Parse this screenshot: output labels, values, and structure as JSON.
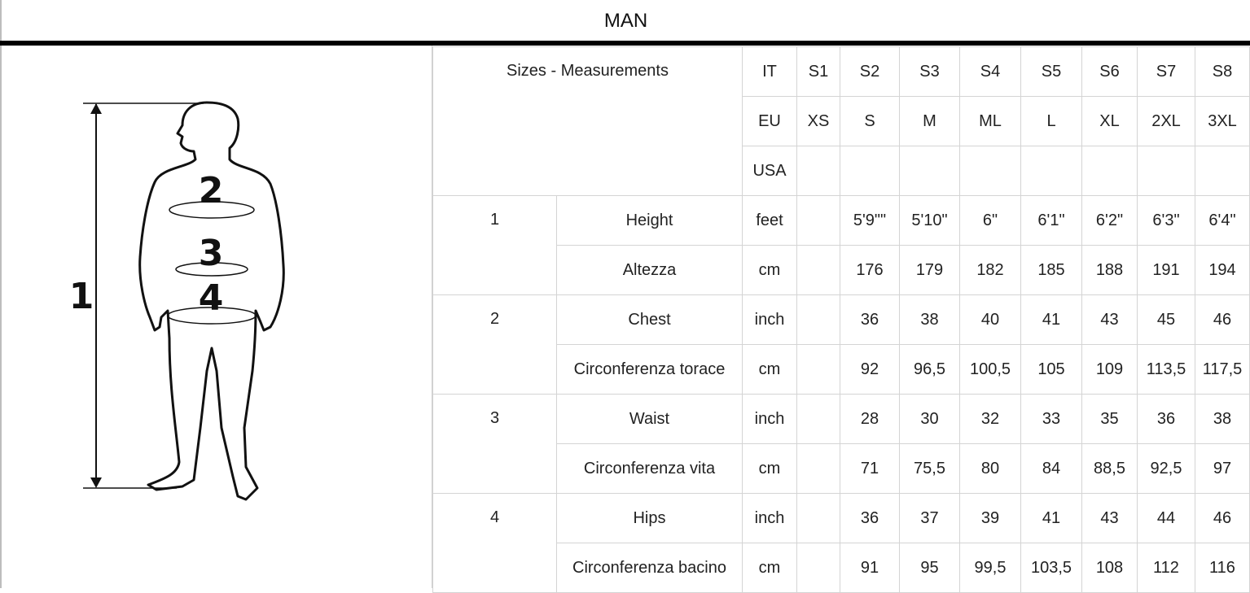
{
  "title": "MAN",
  "figure": {
    "labels": [
      "1",
      "2",
      "3",
      "4"
    ]
  },
  "table": {
    "corner_label": "Sizes - Measurements",
    "size_systems": [
      {
        "system": "IT",
        "sizes": [
          "S1",
          "S2",
          "S3",
          "S4",
          "S5",
          "S6",
          "S7",
          "S8"
        ]
      },
      {
        "system": "EU",
        "sizes": [
          "XS",
          "S",
          "M",
          "ML",
          "L",
          "XL",
          "2XL",
          "3XL"
        ]
      },
      {
        "system": "USA",
        "sizes": [
          "",
          "",
          "",
          "",
          "",
          "",
          "",
          ""
        ]
      }
    ],
    "measurements": [
      {
        "number": "1",
        "rows": [
          {
            "name": "Height",
            "unit": "feet",
            "values": [
              "",
              "5'9\"\"",
              "5'10\"",
              "6\"",
              "6'1\"",
              "6'2\"",
              "6'3\"",
              "6'4\""
            ]
          },
          {
            "name": "Altezza",
            "unit": "cm",
            "values": [
              "",
              "176",
              "179",
              "182",
              "185",
              "188",
              "191",
              "194"
            ]
          }
        ]
      },
      {
        "number": "2",
        "rows": [
          {
            "name": "Chest",
            "unit": "inch",
            "values": [
              "",
              "36",
              "38",
              "40",
              "41",
              "43",
              "45",
              "46"
            ]
          },
          {
            "name": "Circonferenza torace",
            "unit": "cm",
            "values": [
              "",
              "92",
              "96,5",
              "100,5",
              "105",
              "109",
              "113,5",
              "117,5"
            ]
          }
        ]
      },
      {
        "number": "3",
        "rows": [
          {
            "name": "Waist",
            "unit": "inch",
            "values": [
              "",
              "28",
              "30",
              "32",
              "33",
              "35",
              "36",
              "38"
            ]
          },
          {
            "name": "Circonferenza vita",
            "unit": "cm",
            "values": [
              "",
              "71",
              "75,5",
              "80",
              "84",
              "88,5",
              "92,5",
              "97"
            ]
          }
        ]
      },
      {
        "number": "4",
        "rows": [
          {
            "name": "Hips",
            "unit": "inch",
            "values": [
              "",
              "36",
              "37",
              "39",
              "41",
              "43",
              "44",
              "46"
            ]
          },
          {
            "name": "Circonferenza bacino",
            "unit": "cm",
            "values": [
              "",
              "91",
              "95",
              "99,5",
              "103,5",
              "108",
              "112",
              "116"
            ]
          }
        ]
      }
    ]
  }
}
